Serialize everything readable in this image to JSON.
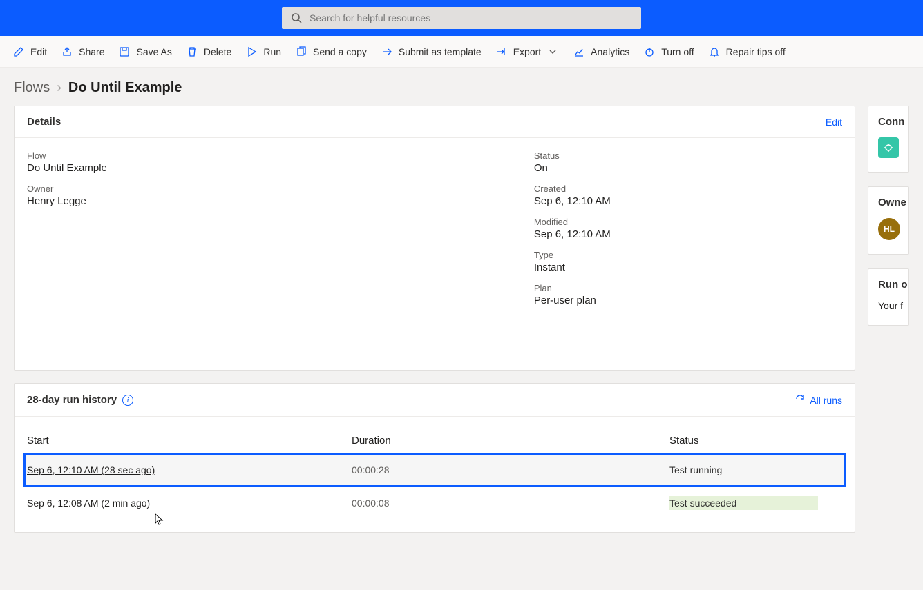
{
  "search": {
    "placeholder": "Search for helpful resources"
  },
  "commands": {
    "edit": "Edit",
    "share": "Share",
    "save_as": "Save As",
    "delete": "Delete",
    "run": "Run",
    "send_copy": "Send a copy",
    "submit_template": "Submit as template",
    "export": "Export",
    "analytics": "Analytics",
    "turn_off": "Turn off",
    "repair_tips": "Repair tips off"
  },
  "breadcrumb": {
    "root": "Flows",
    "current": "Do Until Example"
  },
  "details": {
    "title": "Details",
    "edit_link": "Edit",
    "flow_label": "Flow",
    "flow_value": "Do Until Example",
    "owner_label": "Owner",
    "owner_value": "Henry Legge",
    "status_label": "Status",
    "status_value": "On",
    "created_label": "Created",
    "created_value": "Sep 6, 12:10 AM",
    "modified_label": "Modified",
    "modified_value": "Sep 6, 12:10 AM",
    "type_label": "Type",
    "type_value": "Instant",
    "plan_label": "Plan",
    "plan_value": "Per-user plan"
  },
  "history": {
    "title": "28-day run history",
    "all_runs": "All runs",
    "col_start": "Start",
    "col_duration": "Duration",
    "col_status": "Status",
    "rows": [
      {
        "start": "Sep 6, 12:10 AM (28 sec ago)",
        "duration": "00:00:28",
        "status": "Test running",
        "status_kind": "running",
        "selected": true
      },
      {
        "start": "Sep 6, 12:08 AM (2 min ago)",
        "duration": "00:00:08",
        "status": "Test succeeded",
        "status_kind": "succeeded",
        "selected": false
      }
    ]
  },
  "side": {
    "connections_title": "Conn",
    "owners_title": "Owne",
    "owner_initials": "HL",
    "run_only_title": "Run o",
    "run_only_text": "Your f"
  }
}
